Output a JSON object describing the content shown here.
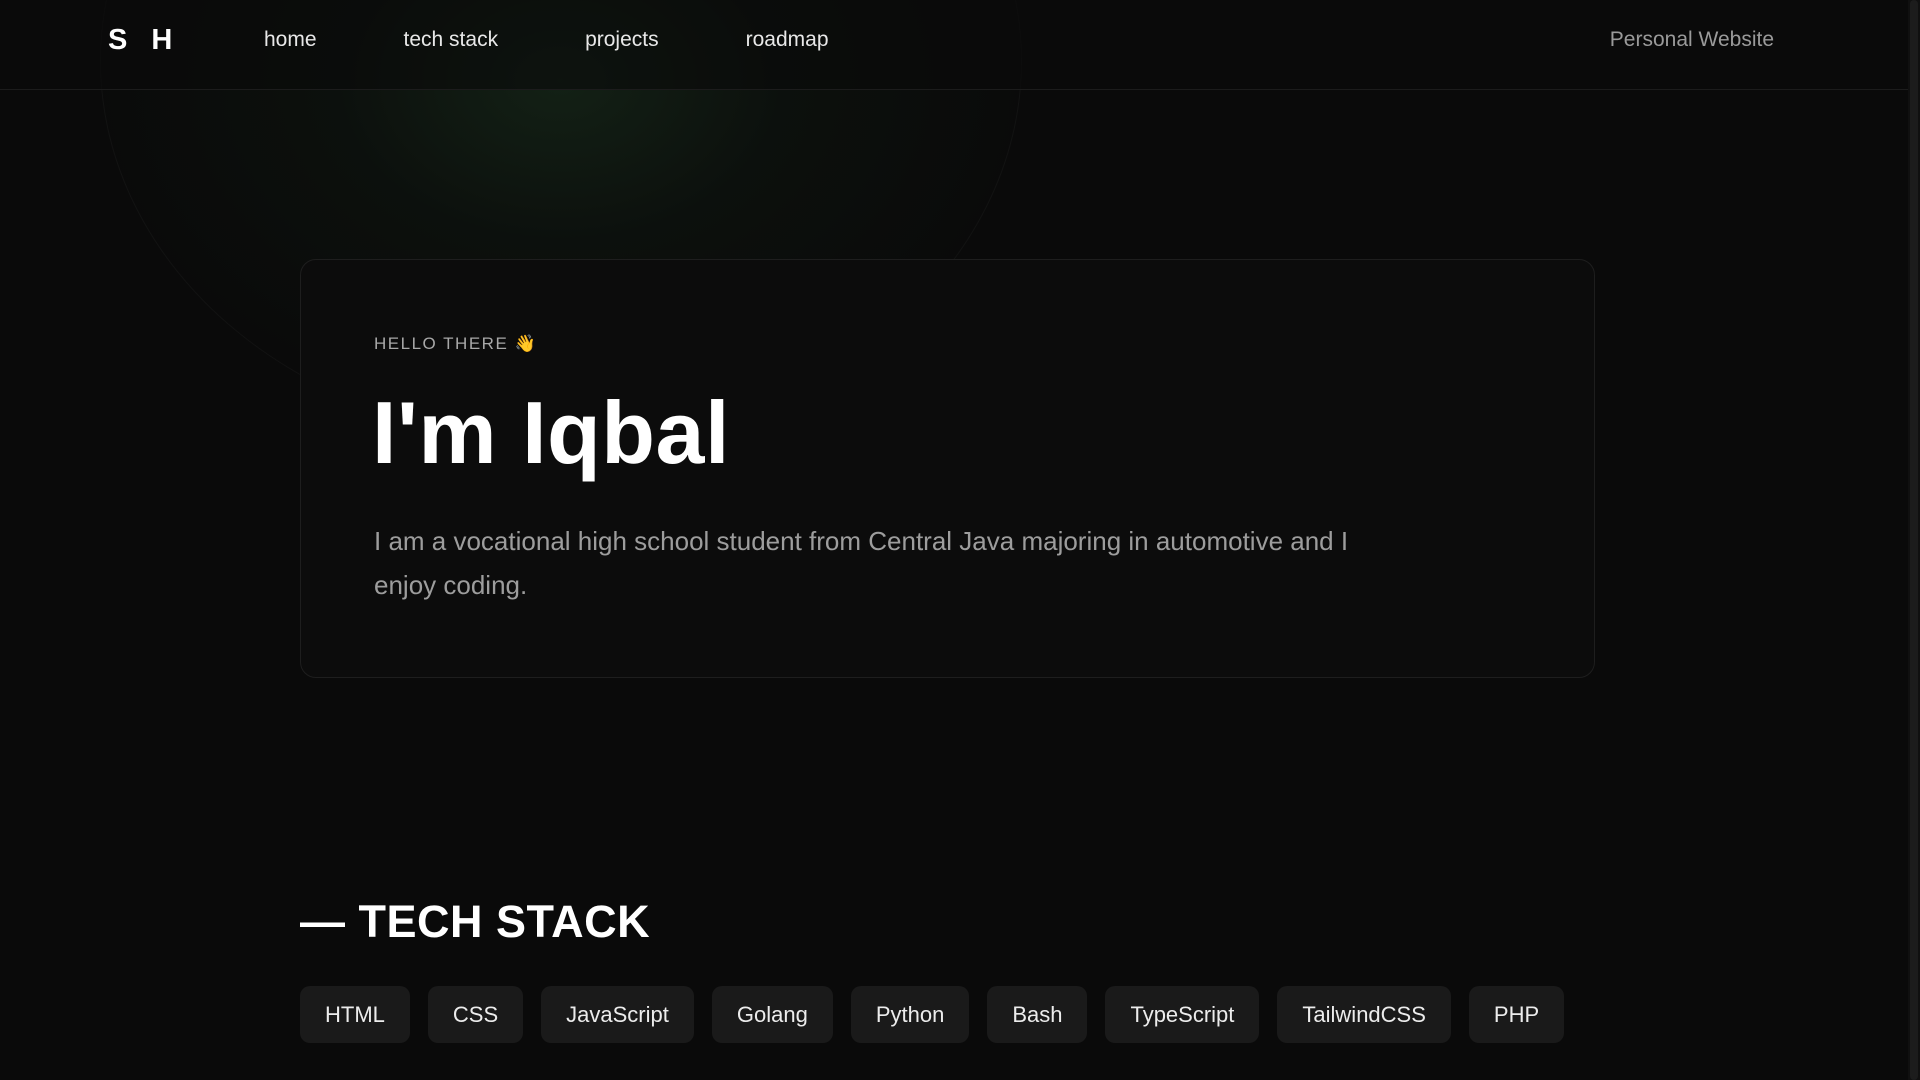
{
  "navbar": {
    "logo": "S H",
    "links": [
      {
        "label": "home"
      },
      {
        "label": "tech stack"
      },
      {
        "label": "projects"
      },
      {
        "label": "roadmap"
      }
    ],
    "tag": "Personal Website"
  },
  "hero": {
    "eyebrow": "HELLO THERE 👋",
    "title": "I'm Iqbal",
    "description": "I am a vocational high school student from Central Java majoring in automotive and I enjoy coding."
  },
  "tech_stack": {
    "title": "— TECH STACK",
    "items": [
      "HTML",
      "CSS",
      "JavaScript",
      "Golang",
      "Python",
      "Bash",
      "TypeScript",
      "TailwindCSS",
      "PHP"
    ]
  },
  "colors": {
    "background": "#0a0a0a",
    "card_border": "#1e1e1e",
    "chip_background": "#1a1a1a",
    "accent_glow": "#224628"
  }
}
